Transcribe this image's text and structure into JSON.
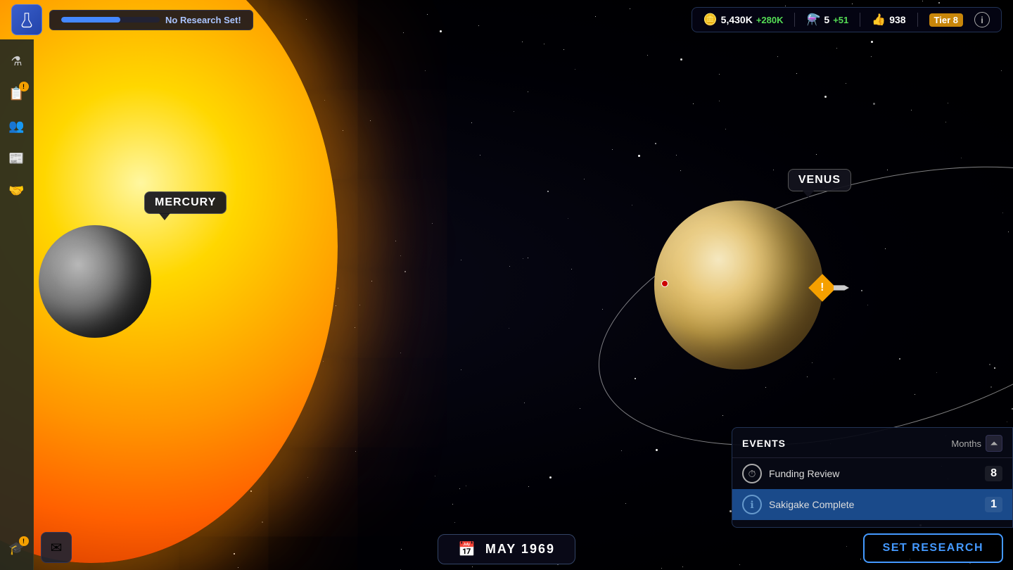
{
  "header": {
    "research_bar": {
      "no_research_text": "No Research Set!",
      "progress": 60
    },
    "stats": {
      "coins": "5,430K",
      "coins_bonus": "+280K",
      "flasks": "5",
      "flasks_bonus": "+51",
      "thumbs": "938",
      "tier_label": "Tier 8"
    }
  },
  "planets": {
    "mercury": {
      "label": "MERCURY"
    },
    "venus": {
      "label": "VENUS"
    }
  },
  "sidebar": {
    "items": [
      {
        "icon": "flask",
        "badge": null,
        "label": "Research"
      },
      {
        "icon": "list",
        "badge": "!",
        "label": "Missions"
      },
      {
        "icon": "people",
        "badge": null,
        "label": "Personnel"
      },
      {
        "icon": "newspaper",
        "badge": null,
        "label": "Reports"
      },
      {
        "icon": "handshake",
        "badge": null,
        "label": "Contracts"
      },
      {
        "icon": "graduation",
        "badge": "!",
        "label": "Training"
      }
    ]
  },
  "date_display": {
    "label": "MAY 1969"
  },
  "events": {
    "title": "EVENTS",
    "filter_label": "Months",
    "rows": [
      {
        "icon": "clock",
        "icon_type": "normal",
        "name": "Funding Review",
        "count": "8",
        "highlighted": false
      },
      {
        "icon": "info",
        "icon_type": "info",
        "name": "Sakigake Complete",
        "count": "1",
        "highlighted": true
      }
    ]
  },
  "buttons": {
    "set_research": "SET RESEARCH",
    "email": "✉"
  }
}
